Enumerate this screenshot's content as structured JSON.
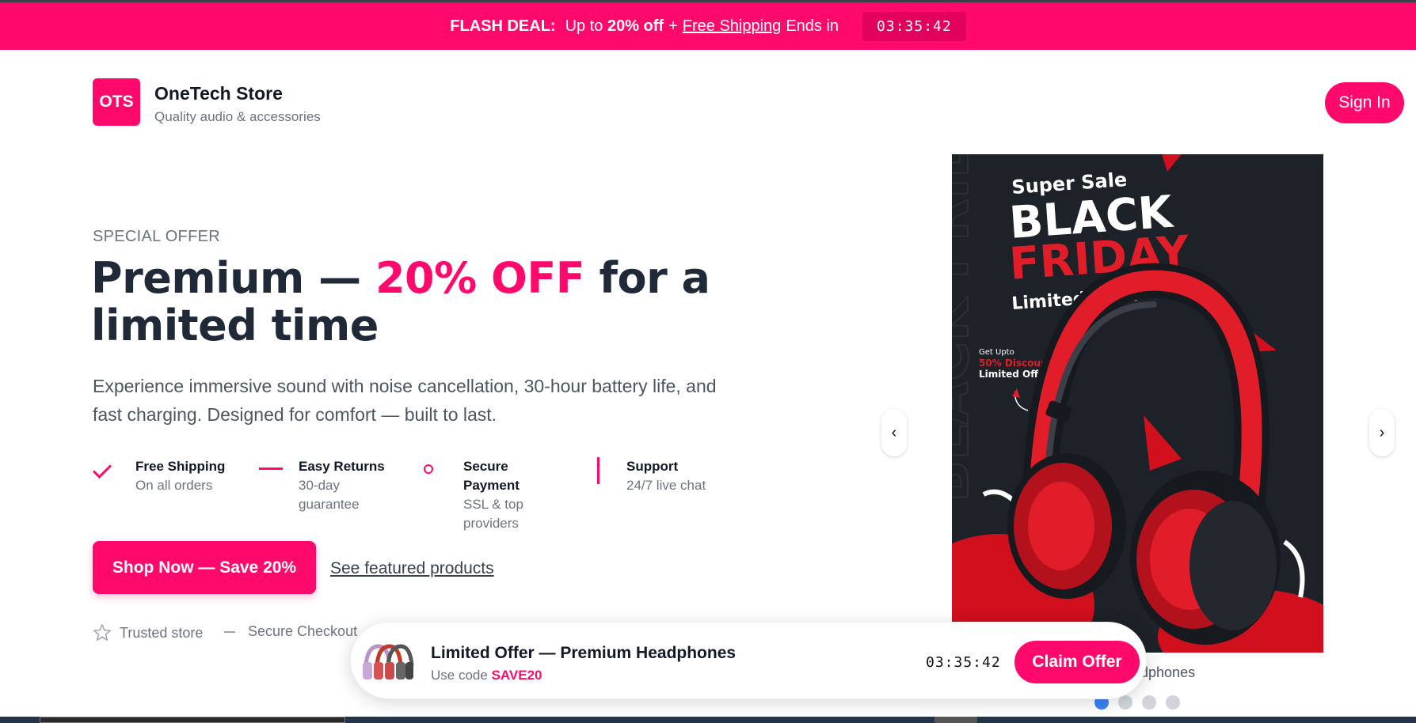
{
  "flash_bar": {
    "label": "FLASH DEAL:",
    "text_prefix": "Up to",
    "discount": "20% off",
    "plus": "+",
    "shipping_link": "Free Shipping",
    "ends_text": "Ends in",
    "timer": "03:35:42"
  },
  "header": {
    "logo_text": "OTS",
    "brand_name": "OneTech Store",
    "tagline": "Quality audio & accessories",
    "signin_label": "Sign In"
  },
  "hero": {
    "eyebrow": "SPECIAL OFFER",
    "headline_part1": "Premium —",
    "headline_accent": "20% OFF",
    "headline_part2": "for a limited time",
    "description": "Experience immersive sound with noise cancellation, 30-hour battery life, and fast charging. Designed for comfort — built to last.",
    "features": [
      {
        "icon": "check-icon",
        "title": "Free Shipping",
        "sub": "On all orders"
      },
      {
        "icon": "dash-icon",
        "title": "Easy Returns",
        "sub": "30-day guarantee"
      },
      {
        "icon": "ring-icon",
        "title": "Secure Payment",
        "sub": "SSL & top providers"
      },
      {
        "icon": "bar-icon",
        "title": "Support",
        "sub": "24/7 live chat"
      }
    ],
    "shop_button": "Shop Now — Save 20%",
    "featured_link": "See featured products",
    "trust": [
      {
        "icon": "star-icon",
        "label": "Trusted store"
      },
      {
        "icon": "dash-icon",
        "label": "Secure Checkout"
      }
    ]
  },
  "carousel": {
    "poster": {
      "super_sale": "Super Sale",
      "black": "BLACK",
      "friday": "FRIDAY",
      "limited": "Limited Offer",
      "get_upto": "Get Upto",
      "discount": "50% Discount",
      "limited_small": "Limited Offer",
      "background_word": "BLACK FRIDAY"
    },
    "caption_visible": "adphones",
    "prev": "‹",
    "next": "›",
    "slide_count": 4,
    "active_index": 0
  },
  "promo_bar": {
    "title": "Limited Offer — Premium Headphones",
    "sub_prefix": "Use code",
    "code": "SAVE20",
    "timer": "03:35:42",
    "claim_label": "Claim Offer"
  },
  "colors": {
    "brand": "#ff0a6c",
    "dark_text": "#1f2937",
    "muted_text": "#6b7280",
    "dot_active": "#3b82f6",
    "poster_bg": "#1d2128",
    "poster_red": "#e11d2a"
  }
}
